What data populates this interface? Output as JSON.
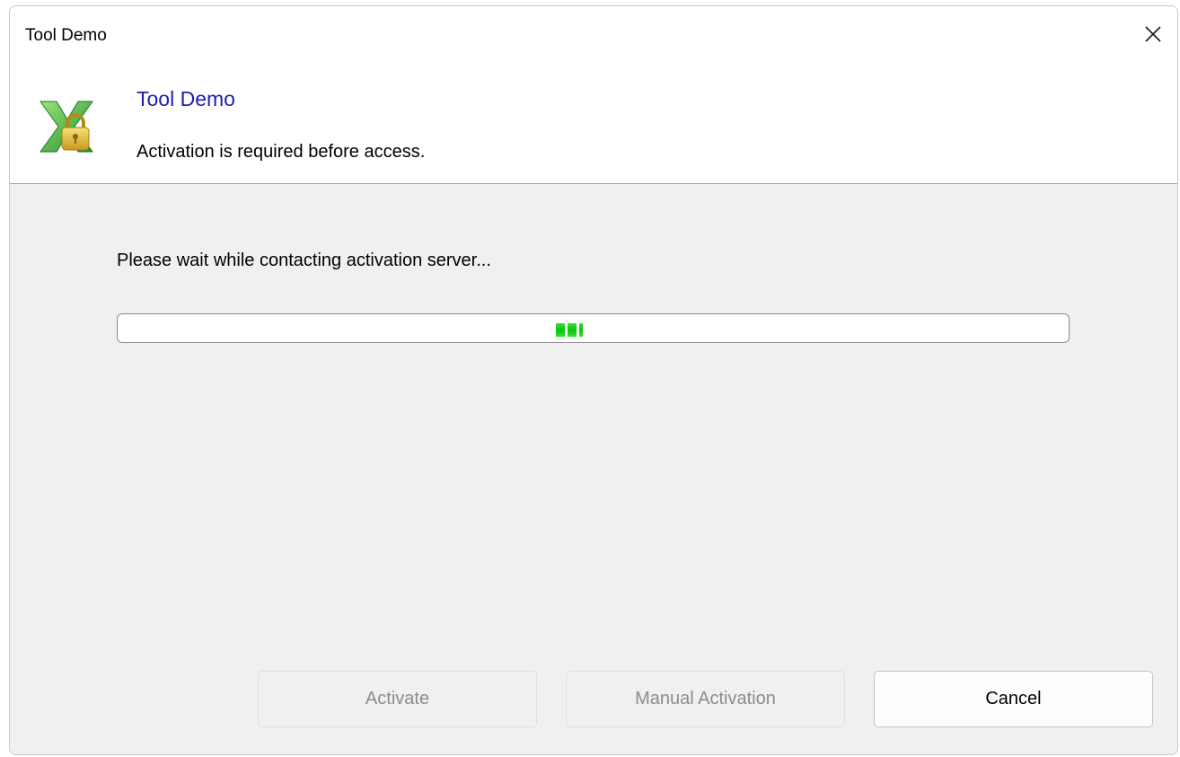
{
  "window": {
    "title": "Tool Demo"
  },
  "header": {
    "title": "Tool Demo",
    "subtitle": "Activation is required before access.",
    "icon": "excel-lock-icon"
  },
  "main": {
    "status": "Please wait while contacting activation server...",
    "progress": {
      "mode": "indeterminate",
      "color": "#22dd22"
    }
  },
  "buttons": {
    "activate": "Activate",
    "manual_activation": "Manual Activation",
    "cancel": "Cancel"
  },
  "colors": {
    "header_title": "#1e1eb4",
    "disabled_text": "#8c8c8c"
  }
}
